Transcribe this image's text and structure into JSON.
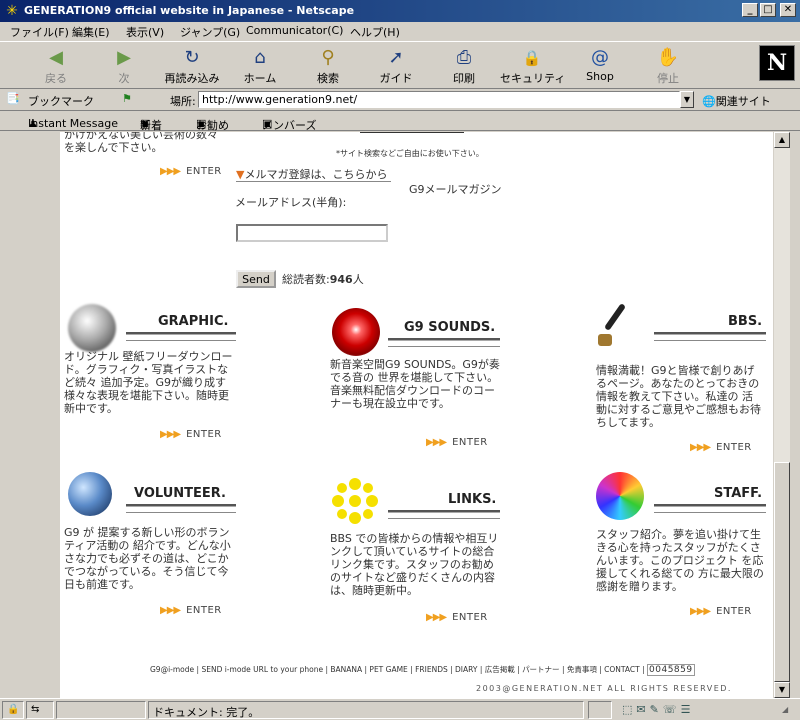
{
  "window": {
    "title": "GENERATION9 official website in Japanese - Netscape",
    "controls": {
      "minimize": "_",
      "maximize": "□",
      "close": "✕"
    }
  },
  "menu": [
    "ファイル(F)",
    "編集(E)",
    "表示(V)",
    "ジャンプ(G)",
    "Communicator(C)",
    "ヘルプ(H)"
  ],
  "toolbar": [
    {
      "label": "戻る",
      "icon": "back-arrow-icon",
      "glyph": "◀",
      "enabled": false
    },
    {
      "label": "次",
      "icon": "forward-arrow-icon",
      "glyph": "▶",
      "enabled": false
    },
    {
      "label": "再読み込み",
      "icon": "reload-icon",
      "glyph": "↻",
      "enabled": true
    },
    {
      "label": "ホーム",
      "icon": "home-icon",
      "glyph": "⌂",
      "enabled": true
    },
    {
      "label": "検索",
      "icon": "search-icon",
      "glyph": "⚲",
      "enabled": true
    },
    {
      "label": "ガイド",
      "icon": "guide-icon",
      "glyph": "➚",
      "enabled": true
    },
    {
      "label": "印刷",
      "icon": "print-icon",
      "glyph": "⎙",
      "enabled": true
    },
    {
      "label": "セキュリティ",
      "icon": "security-lock-icon",
      "glyph": "🔒",
      "enabled": true
    },
    {
      "label": "Shop",
      "icon": "shop-icon",
      "glyph": "@",
      "enabled": true
    },
    {
      "label": "停止",
      "icon": "stop-icon",
      "glyph": "✋",
      "enabled": false
    }
  ],
  "location": {
    "bookmark_label": "ブックマーク",
    "location_label": "場所:",
    "url": "http://www.generation9.net/",
    "related_label": "関連サイト"
  },
  "personal_bar": [
    "Instant Message",
    "新着",
    "お勧め",
    "メンバーズ"
  ],
  "page": {
    "top_partial_text_1": "かけがえない美しい芸術の数々",
    "top_partial_text_2": "を楽しんで下さい。",
    "site_search_note": "*サイト検索などご自由にお使い下さい。",
    "enter_label": "ENTER",
    "mailmag_link": "メルマガ登録は、こちらから",
    "mailmag_title": "G9メールマガジン",
    "email_label": "メールアドレス(半角):",
    "email_value": "",
    "send_label": "Send",
    "readers_label": "総読者数:",
    "readers_count": "946",
    "readers_unit": "人",
    "sections": [
      {
        "title": "GRAPHIC.",
        "text": "オリジナル 壁紙フリーダウンロード。グラフィク・写真イラストなど続々 追加予定。G9が織り成す様々な表現を堪能下さい。随時更新中です。",
        "color": "#999999"
      },
      {
        "title": "G9 SOUNDS.",
        "text": "新音楽空間G9 SOUNDS。G9が奏でる音の 世界を堪能して下さい。音楽無料配信ダウンロードのコーナーも現在設立中です。",
        "color": "#cc0000"
      },
      {
        "title": "BBS.",
        "text": "情報満載！G9と皆様で創りあげるページ。あなたのとっておきの情報を教えて下さい。私達の 活動に対するご意見やご感想もお待ちしてます。",
        "color": "#8a6a20"
      },
      {
        "title": "VOLUNTEER.",
        "text": "G9 が 提案する新しい形のボランティア活動の 紹介です。どんな小さな力でも必ずその道は、どこかでつながっている。そう信じて今日も前進です。",
        "color": "#4a7ab0"
      },
      {
        "title": "LINKS.",
        "text": "BBS での皆様からの情報や相互リンクして頂いているサイトの総合リンク集です。スタッフのお勧めのサイトなど盛りだくさんの内容は、随時更新中。",
        "color": "#f5e000"
      },
      {
        "title": "STAFF.",
        "text": "スタッフ紹介。夢を追い掛けて生きる心を持ったスタッフがたくさんいます。このプロジェクト を応援してくれる総ての 方に最大限の感謝を贈ります。",
        "color": "#44aa44"
      }
    ],
    "footer_links": [
      "G9@i-mode",
      "SEND i-mode URL to your phone",
      "BANANA",
      "PET GAME",
      "FRIENDS",
      "DIARY",
      "広告掲載",
      "パートナー",
      "免責事項",
      "CONTACT"
    ],
    "counter": "0045859",
    "copyright": "2003@GENERATION.NET ALL RIGHTS RESERVED."
  },
  "status": {
    "message": "ドキュメント: 完了。"
  }
}
